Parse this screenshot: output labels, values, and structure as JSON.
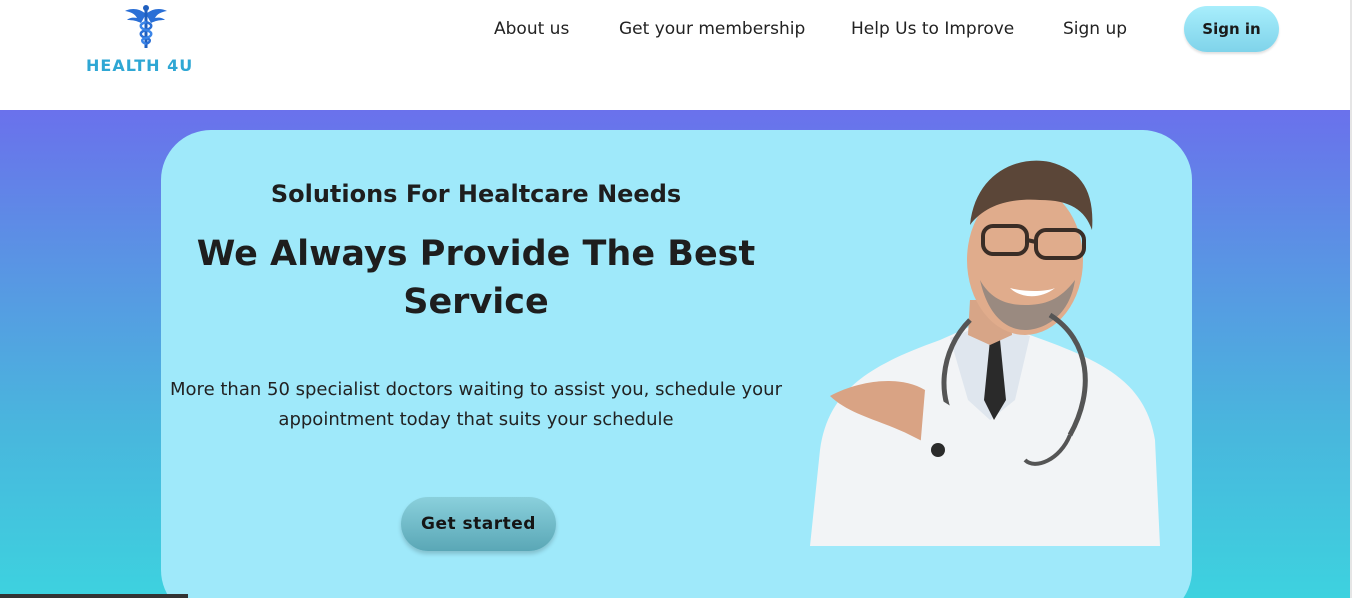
{
  "brand": {
    "name": "HEALTH 4U",
    "logo_icon": "caduceus-icon",
    "color": "#2fa7d4"
  },
  "nav": {
    "items": [
      {
        "label": "About us"
      },
      {
        "label": "Get your membership"
      },
      {
        "label": "Help Us to Improve"
      },
      {
        "label": "Sign up"
      }
    ],
    "signin_label": "Sign in"
  },
  "hero": {
    "subtitle": "Solutions For Healtcare Needs",
    "title": "We Always Provide The Best Service",
    "description": "More than 50 specialist doctors waiting to assist you, schedule your appointment today that suits your schedule",
    "cta_label": "Get started",
    "image": "doctor-illustration"
  },
  "colors": {
    "gradient_top": "#6a71ec",
    "gradient_bottom": "#3dd2df",
    "card": "#9fe9fa",
    "button": "#7fd3ea"
  }
}
